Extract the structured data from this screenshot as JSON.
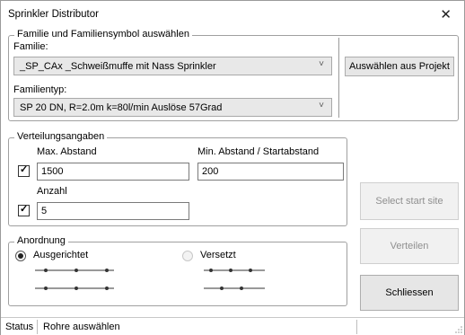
{
  "window": {
    "title": "Sprinkler Distributor"
  },
  "family_group": {
    "legend": "Familie und Familiensymbol auswählen",
    "family_label": "Familie:",
    "family_value": "_SP_CAx _Schweißmuffe mit Nass Sprinkler",
    "type_label": "Familientyp:",
    "type_value": "SP 20 DN, R=2.0m k=80l/min Auslöse 57Grad",
    "select_button": "Auswählen aus Projekt"
  },
  "distribution_group": {
    "legend": "Verteilungsangaben",
    "max_label": "Max. Abstand",
    "max_value": "1500",
    "min_label": "Min. Abstand / Startabstand",
    "min_value": "200",
    "count_label": "Anzahl",
    "count_value": "5"
  },
  "arrangement_group": {
    "legend": "Anordnung",
    "aligned_label": "Ausgerichtet",
    "staggered_label": "Versetzt"
  },
  "buttons": {
    "select_start_site": "Select  start site",
    "distribute": "Verteilen",
    "close": "Schliessen"
  },
  "statusbar": {
    "label": "Status",
    "message": "Rohre auswählen"
  }
}
